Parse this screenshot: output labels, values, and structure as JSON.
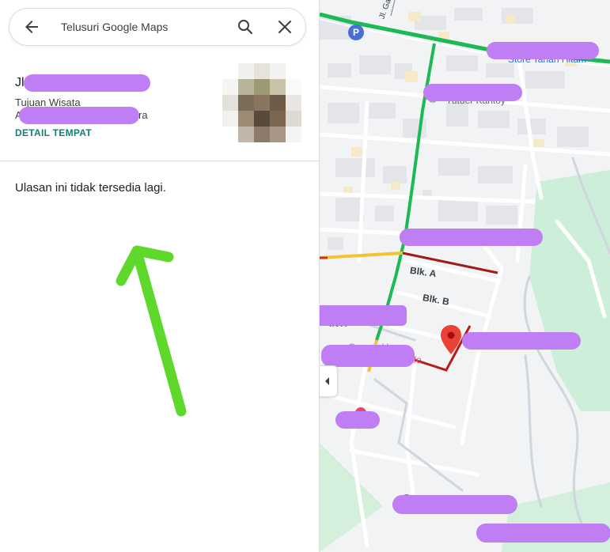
{
  "search": {
    "value": "Telusuri Google Maps"
  },
  "place": {
    "name_visible": "Jl",
    "category": "Tujuan Wisata",
    "address_prefix": "A",
    "address_suffix": "ra",
    "detail_link": "DETAIL TEMPAT"
  },
  "review": {
    "message": "Ulasan ini tidak tersedia lagi."
  },
  "map": {
    "labels": {
      "blk_a": "Blk. A",
      "blk_b": "Blk. B",
      "street_jl_top": "Jl. Ga",
      "store_partial": "Store Tanah Hitam",
      "place_partial_2": "Tutuer Kantoy",
      "place_partial_3": "Gerson H",
      "place_partial_4": "afe",
      "place_partial_5": "INTI"
    }
  },
  "colors": {
    "accent_link": "#137f6f",
    "redaction": "#c07ef5",
    "annotation_arrow": "#5ed82b",
    "map_pin": "#ea4335",
    "traffic_green": "#1db954",
    "traffic_red": "#9e1c1c",
    "road_yellow": "#f4c430"
  }
}
